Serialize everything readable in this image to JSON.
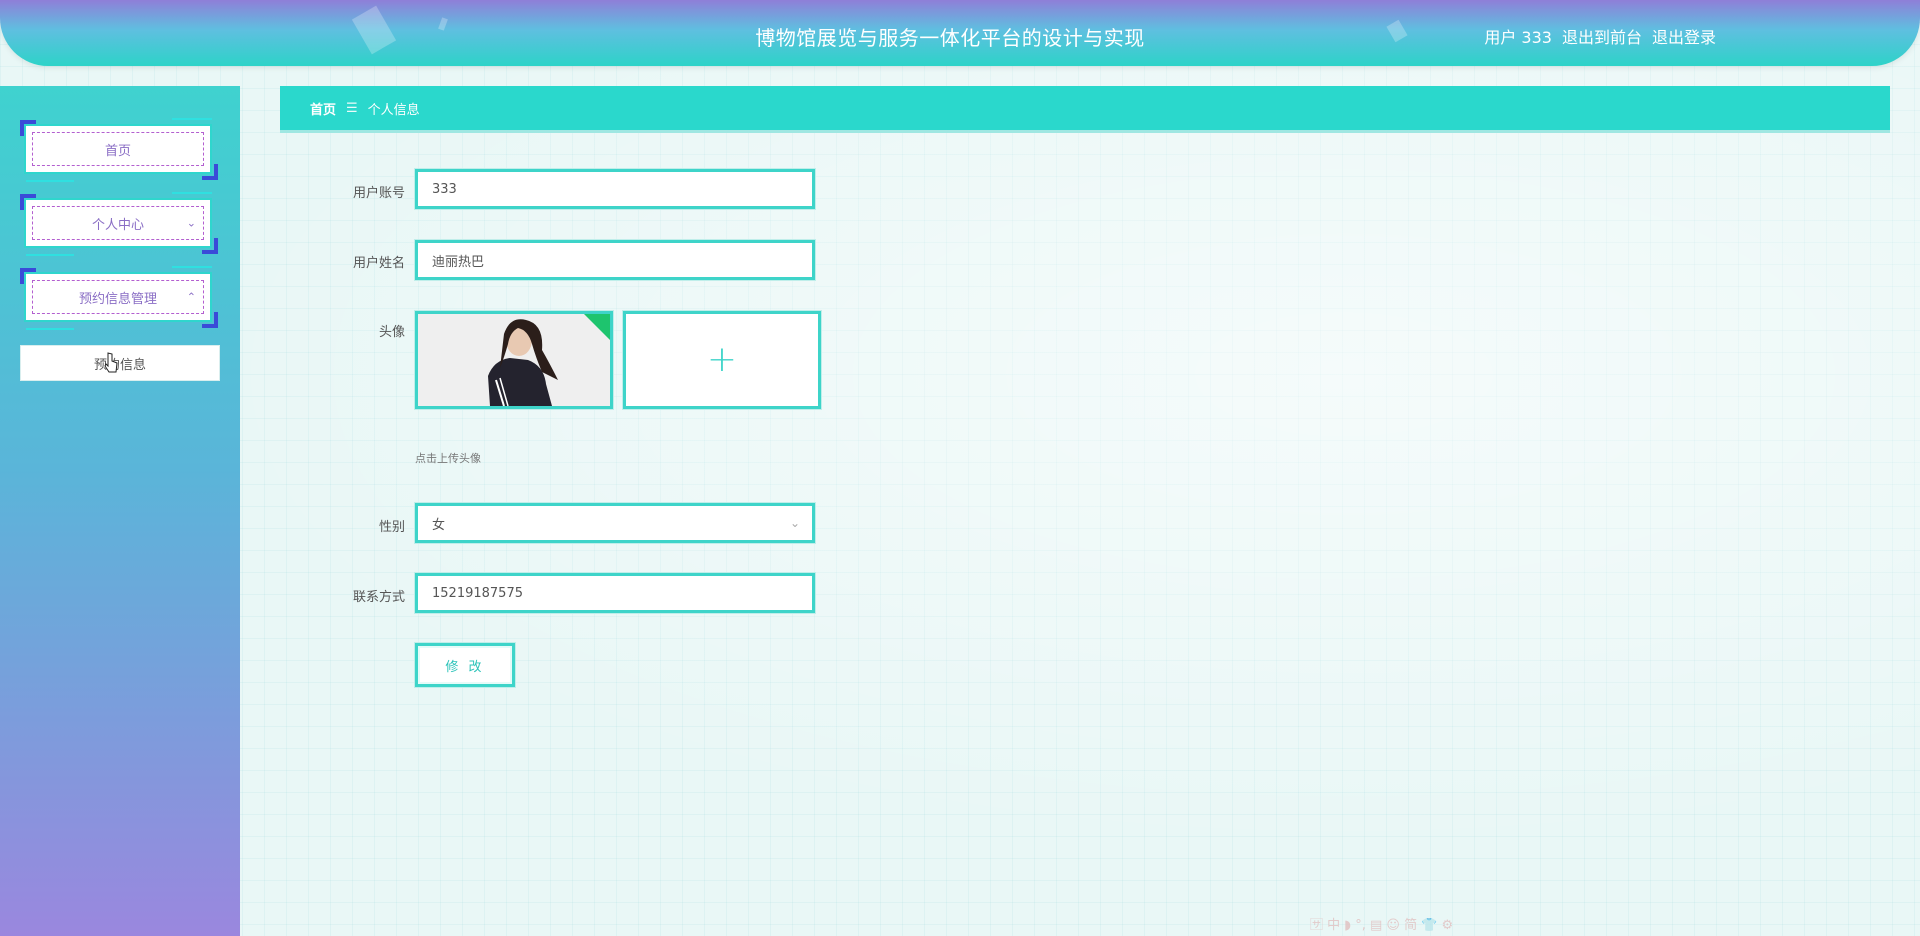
{
  "header": {
    "title": "博物馆展览与服务一体化平台的设计与实现",
    "user_label": "用户 333",
    "to_front": "退出到前台",
    "logout": "退出登录"
  },
  "sidebar": {
    "items": [
      {
        "label": "首页",
        "chevron": ""
      },
      {
        "label": "个人中心",
        "chevron": "⌄"
      },
      {
        "label": "预约信息管理",
        "chevron": "⌃"
      }
    ],
    "submenu": {
      "label": "预约信息"
    }
  },
  "breadcrumb": {
    "home": "首页",
    "separator": "☰",
    "current": "个人信息"
  },
  "form": {
    "account": {
      "label": "用户账号",
      "value": "333"
    },
    "name": {
      "label": "用户姓名",
      "value": "迪丽热巴"
    },
    "avatar": {
      "label": "头像",
      "tip": "点击上传头像"
    },
    "gender": {
      "label": "性别",
      "value": "女"
    },
    "phone": {
      "label": "联系方式",
      "value": "15219187575"
    },
    "submit": "修 改"
  },
  "ime_toolbar": "🈂 中 ◗ °, ▤ ☺ 简 👕 ⚙",
  "colors": {
    "accent": "#2ad8cc",
    "frame_corner": "#3a4bd8",
    "sidebar_text": "#8a6ec5"
  }
}
